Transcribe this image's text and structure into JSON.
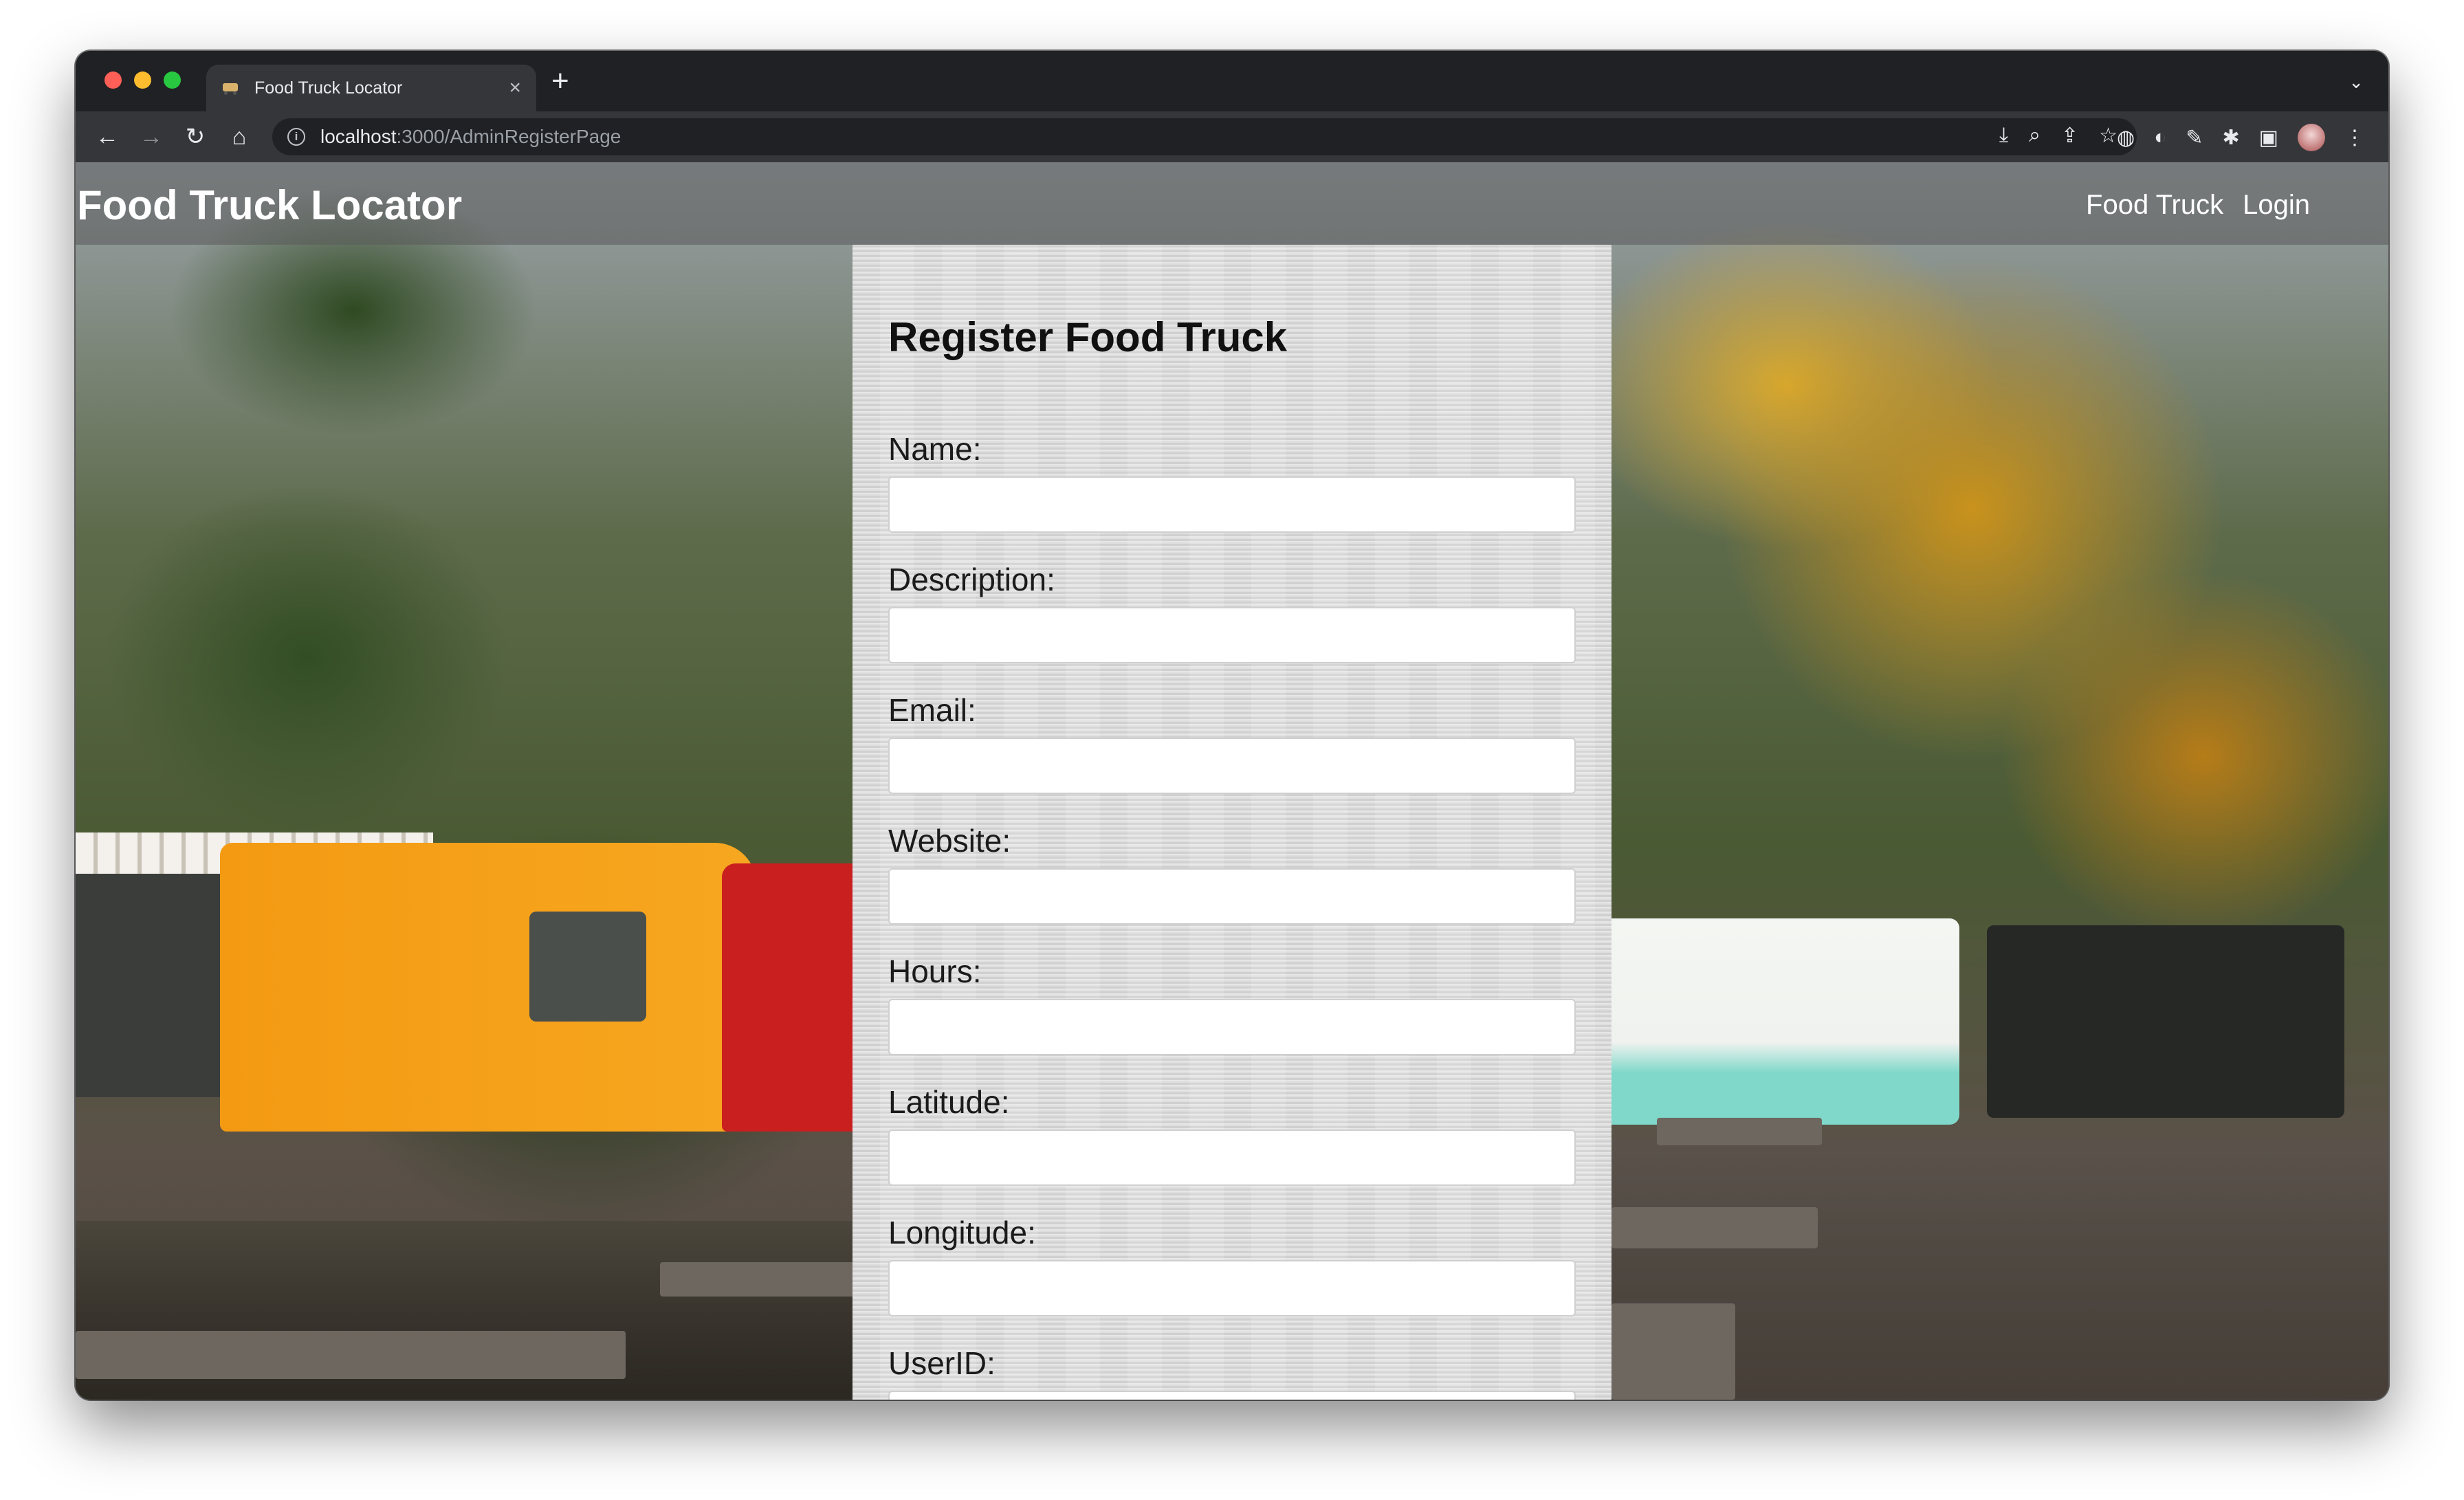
{
  "browser": {
    "tab_title": "Food Truck Locator",
    "tab_close": "×",
    "new_tab": "+",
    "tabs_menu": "⌄",
    "url_host": "localhost",
    "url_path": ":3000/AdminRegisterPage",
    "info_glyph": "i",
    "nav": {
      "back": "←",
      "forward": "→",
      "reload": "↻",
      "home": "⌂"
    },
    "omnibox_actions": [
      "⤓",
      "⌕",
      "⇪",
      "☆"
    ],
    "extension_icons": [
      "◍",
      "◐",
      "✎",
      "✱",
      "▣",
      "⋮"
    ]
  },
  "site": {
    "brand": "Food Truck Locator",
    "nav": [
      "Food Truck",
      "Login"
    ]
  },
  "form": {
    "title": "Register Food Truck",
    "fields": [
      {
        "label": "Name:",
        "value": ""
      },
      {
        "label": "Description:",
        "value": ""
      },
      {
        "label": "Email:",
        "value": ""
      },
      {
        "label": "Website:",
        "value": ""
      },
      {
        "label": "Hours:",
        "value": ""
      },
      {
        "label": "Latitude:",
        "value": ""
      },
      {
        "label": "Longitude:",
        "value": ""
      },
      {
        "label": "UserID:",
        "value": ""
      }
    ]
  },
  "colors": {
    "chrome_dark": "#202124",
    "toolbar": "#35363a",
    "card_bg": "#dcdcdc"
  }
}
